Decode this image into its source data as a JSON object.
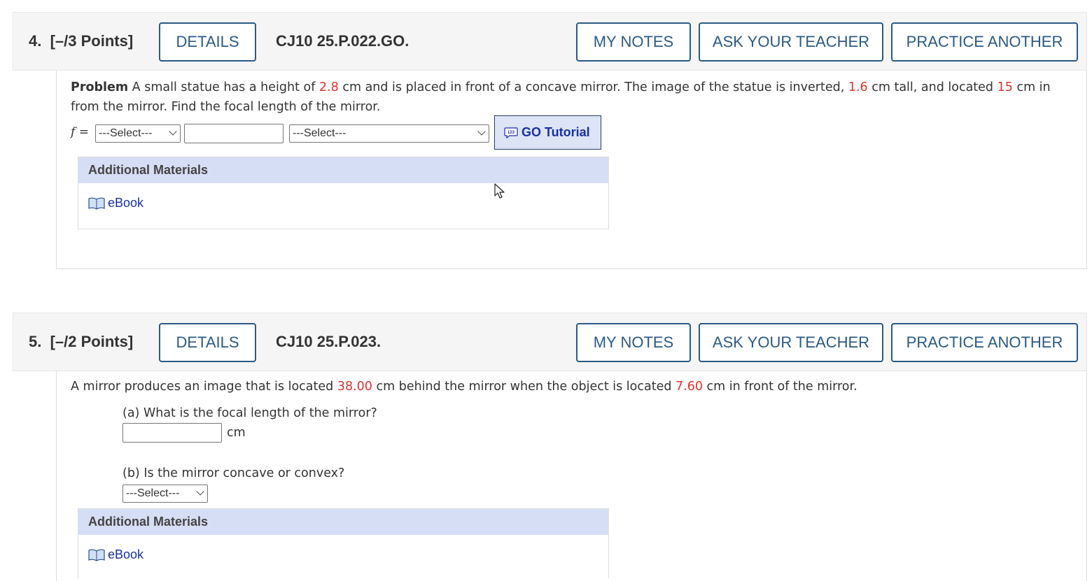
{
  "questions": [
    {
      "number": "4.",
      "points": "[–/3 Points]",
      "details_label": "DETAILS",
      "code": "CJ10 25.P.022.GO.",
      "my_notes_label": "MY NOTES",
      "ask_teacher_label": "ASK YOUR TEACHER",
      "practice_label": "PRACTICE ANOTHER",
      "problem": {
        "lead": "Problem",
        "t1": " A small statue has a height of ",
        "v1": "2.8",
        "t2": " cm and is placed in front of a concave mirror. The image of the statue is inverted, ",
        "v2": "1.6",
        "t3": " cm tall, and located ",
        "v3": "15",
        "t4": " cm in from the mirror. Find the focal length of the mirror."
      },
      "answer": {
        "var_label": "f",
        "equals": " =",
        "sign_select": "---Select---",
        "value": "",
        "unit_select": "---Select---"
      },
      "go_tutorial_label": "GO Tutorial",
      "additional_materials_label": "Additional Materials",
      "ebook_label": "eBook"
    },
    {
      "number": "5.",
      "points": "[–/2 Points]",
      "details_label": "DETAILS",
      "code": "CJ10 25.P.023.",
      "my_notes_label": "MY NOTES",
      "ask_teacher_label": "ASK YOUR TEACHER",
      "practice_label": "PRACTICE ANOTHER",
      "problem": {
        "t1": "A mirror produces an image that is located ",
        "v1": "38.00",
        "t2": " cm behind the mirror when the object is located ",
        "v2": "7.60",
        "t3": " cm in front of the mirror."
      },
      "part_a": {
        "question": "(a) What is the focal length of the mirror?",
        "value": "",
        "unit": "cm"
      },
      "part_b": {
        "question": "(b) Is the mirror concave or convex?",
        "select": "---Select---"
      },
      "additional_materials_label": "Additional Materials",
      "ebook_label": "eBook"
    }
  ],
  "colors": {
    "accent": "#2a5a84",
    "given_value": "#e0322f",
    "link": "#1a2fa6",
    "panel_header": "#d6def5",
    "header_bg": "#f5f5f5"
  },
  "icons": [
    "chevron-down-icon",
    "tutorial-icon",
    "book-icon",
    "mouse-cursor-icon"
  ]
}
